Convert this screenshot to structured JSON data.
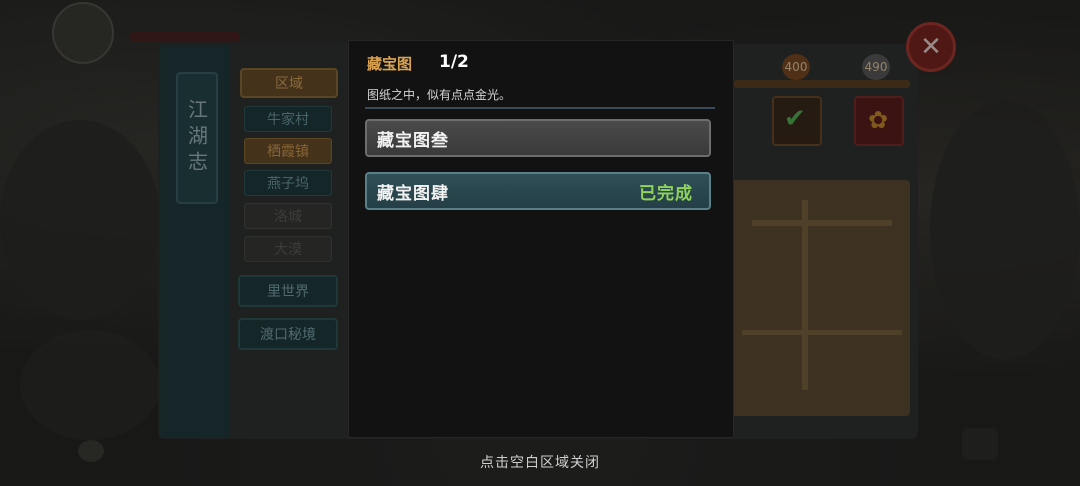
{
  "dialog": {
    "title": "藏宝图",
    "progress": "1/2",
    "description": "图纸之中，似有点点金光。",
    "items": [
      {
        "label": "藏宝图叁",
        "status": ""
      },
      {
        "label": "藏宝图肆",
        "status": "已完成"
      }
    ]
  },
  "close_hint": "点击空白区域关闭",
  "book": {
    "title": "江湖志",
    "region_header": "区域",
    "regions": [
      {
        "label": "牛家村",
        "state": "available"
      },
      {
        "label": "栖霞镇",
        "state": "selected"
      },
      {
        "label": "燕子坞",
        "state": "available"
      },
      {
        "label": "洛城",
        "state": "locked"
      },
      {
        "label": "大漠",
        "state": "locked"
      }
    ],
    "special_regions": [
      "里世界",
      "渡口秘境"
    ]
  },
  "scores": {
    "left": "400",
    "right": "490"
  },
  "colors": {
    "accent_gold": "#d9a150",
    "complete_green": "#8fd35a",
    "close_red": "#7a2520"
  },
  "icons": {
    "close": "close-icon",
    "check": "check-icon",
    "flower": "flower-icon",
    "chat": "chat-icon"
  }
}
